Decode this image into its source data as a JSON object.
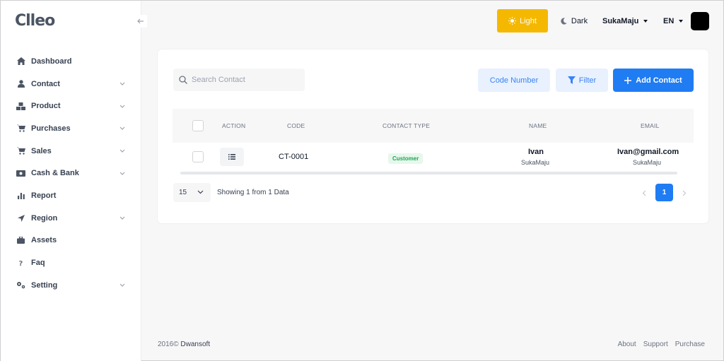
{
  "brand": {
    "logo_text": "Clleo"
  },
  "sidebar": {
    "items": [
      {
        "label": "Dashboard",
        "icon": "home-icon",
        "expandable": false
      },
      {
        "label": "Contact",
        "icon": "user-icon",
        "expandable": true
      },
      {
        "label": "Product",
        "icon": "boxes-icon",
        "expandable": true
      },
      {
        "label": "Purchases",
        "icon": "cart-icon",
        "expandable": true
      },
      {
        "label": "Sales",
        "icon": "cart-icon",
        "expandable": true
      },
      {
        "label": "Cash & Bank",
        "icon": "money-icon",
        "expandable": true
      },
      {
        "label": "Report",
        "icon": "bar-chart-icon",
        "expandable": false
      },
      {
        "label": "Region",
        "icon": "location-arrow-icon",
        "expandable": true
      },
      {
        "label": "Assets",
        "icon": "briefcase-icon",
        "expandable": false
      },
      {
        "label": "Faq",
        "icon": "question-icon",
        "expandable": false
      },
      {
        "label": "Setting",
        "icon": "cogs-icon",
        "expandable": true
      }
    ]
  },
  "topbar": {
    "light_label": "Light",
    "dark_label": "Dark",
    "company": "SukaMaju",
    "language": "EN"
  },
  "toolbar": {
    "search_placeholder": "Search Contact",
    "code_number_label": "Code Number",
    "filter_label": "Filter",
    "add_contact_label": "Add Contact"
  },
  "table": {
    "headers": {
      "action": "ACTION",
      "code": "CODE",
      "contact_type": "CONTACT TYPE",
      "name": "NAME",
      "email": "EMAIL"
    },
    "rows": [
      {
        "code": "CT-0001",
        "contact_type": "Customer",
        "name": "Ivan",
        "name_sub": "SukaMaju",
        "email": "Ivan@gmail.com",
        "email_sub": "SukaMaju"
      }
    ]
  },
  "pagination": {
    "page_size": "15",
    "showing_text": "Showing 1 from 1 Data",
    "current_page": "1"
  },
  "footer": {
    "year": "2016©",
    "company": "Dwansoft",
    "links": [
      "About",
      "Support",
      "Purchase"
    ]
  },
  "colors": {
    "accent": "#1f7cf3",
    "light_button": "#f5b800",
    "badge_bg": "#e6f8ec",
    "badge_text": "#22a355"
  }
}
